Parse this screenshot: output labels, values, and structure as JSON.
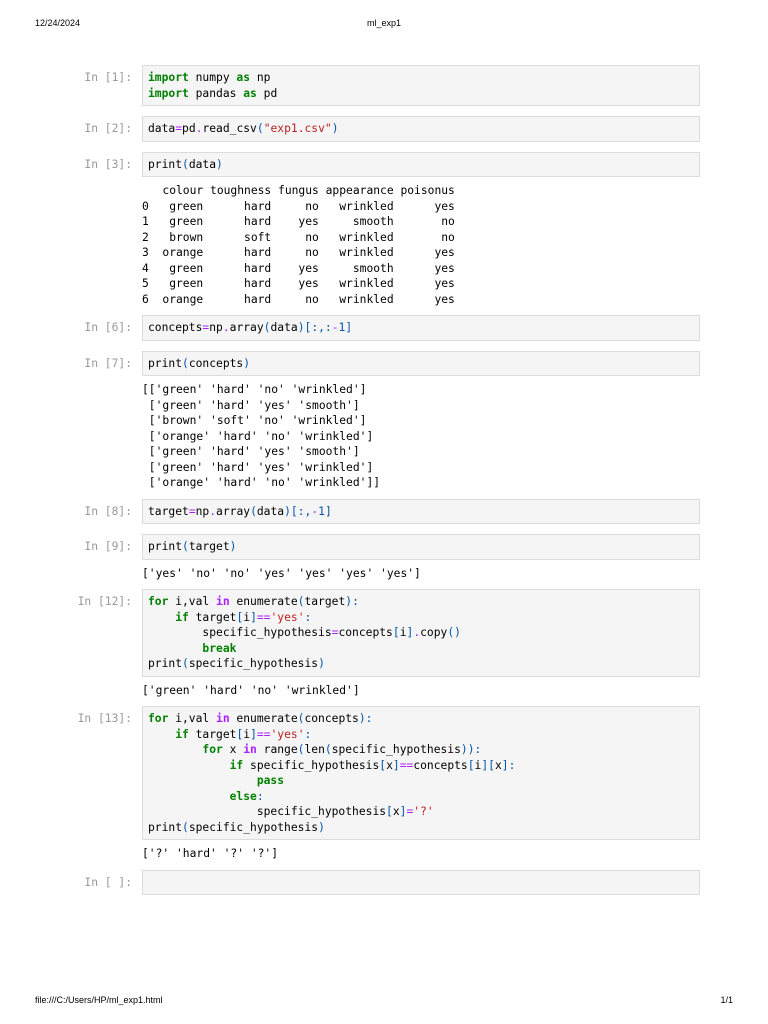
{
  "header": {
    "date": "12/24/2024",
    "title": "ml_exp1"
  },
  "footer": {
    "path": "file:///C:/Users/HP/ml_exp1.html",
    "page": "1/1"
  },
  "cells": [
    {
      "prompt": "In [1]:",
      "code": [
        [
          [
            "import",
            "kw"
          ],
          [
            " numpy ",
            ""
          ],
          [
            "as",
            "kw"
          ],
          [
            " np",
            ""
          ]
        ],
        [
          [
            "import",
            "kw"
          ],
          [
            " pandas ",
            ""
          ],
          [
            "as",
            "kw"
          ],
          [
            " pd",
            ""
          ]
        ]
      ],
      "output": null
    },
    {
      "prompt": "In [2]:",
      "code": [
        [
          [
            "data",
            ""
          ],
          [
            "=",
            "eq"
          ],
          [
            "pd",
            ""
          ],
          [
            ".",
            "eq"
          ],
          [
            "read_csv",
            ""
          ],
          [
            "(",
            "br"
          ],
          [
            "\"exp1.csv\"",
            "str"
          ],
          [
            ")",
            "br"
          ]
        ]
      ],
      "output": null
    },
    {
      "prompt": "In [3]:",
      "code": [
        [
          [
            "print",
            ""
          ],
          [
            "(",
            "br"
          ],
          [
            "data",
            ""
          ],
          [
            ")",
            "br"
          ]
        ]
      ],
      "output": "   colour toughness fungus appearance poisonus\n0   green      hard     no   wrinkled      yes\n1   green      hard    yes     smooth       no\n2   brown      soft     no   wrinkled       no\n3  orange      hard     no   wrinkled      yes\n4   green      hard    yes     smooth      yes\n5   green      hard    yes   wrinkled      yes\n6  orange      hard     no   wrinkled      yes"
    },
    {
      "prompt": "In [6]:",
      "code": [
        [
          [
            "concepts",
            ""
          ],
          [
            "=",
            "eq"
          ],
          [
            "np",
            ""
          ],
          [
            ".",
            "eq"
          ],
          [
            "array",
            ""
          ],
          [
            "(",
            "br"
          ],
          [
            "data",
            ""
          ],
          [
            ")",
            "br"
          ],
          [
            "[",
            "br"
          ],
          [
            ":,:",
            "br"
          ],
          [
            "-",
            "eq"
          ],
          [
            "1",
            "br"
          ],
          [
            "]",
            "br"
          ]
        ]
      ],
      "output": null
    },
    {
      "prompt": "In [7]:",
      "code": [
        [
          [
            "print",
            ""
          ],
          [
            "(",
            "br"
          ],
          [
            "concepts",
            ""
          ],
          [
            ")",
            "br"
          ]
        ]
      ],
      "output": "[['green' 'hard' 'no' 'wrinkled']\n ['green' 'hard' 'yes' 'smooth']\n ['brown' 'soft' 'no' 'wrinkled']\n ['orange' 'hard' 'no' 'wrinkled']\n ['green' 'hard' 'yes' 'smooth']\n ['green' 'hard' 'yes' 'wrinkled']\n ['orange' 'hard' 'no' 'wrinkled']]"
    },
    {
      "prompt": "In [8]:",
      "code": [
        [
          [
            "target",
            ""
          ],
          [
            "=",
            "eq"
          ],
          [
            "np",
            ""
          ],
          [
            ".",
            "eq"
          ],
          [
            "array",
            ""
          ],
          [
            "(",
            "br"
          ],
          [
            "data",
            ""
          ],
          [
            ")",
            "br"
          ],
          [
            "[",
            "br"
          ],
          [
            ":,",
            "br"
          ],
          [
            "-",
            "eq"
          ],
          [
            "1",
            "br"
          ],
          [
            "]",
            "br"
          ]
        ]
      ],
      "output": null
    },
    {
      "prompt": "In [9]:",
      "code": [
        [
          [
            "print",
            ""
          ],
          [
            "(",
            "br"
          ],
          [
            "target",
            ""
          ],
          [
            ")",
            "br"
          ]
        ]
      ],
      "output": "['yes' 'no' 'no' 'yes' 'yes' 'yes' 'yes']"
    },
    {
      "prompt": "In [12]:",
      "code": [
        [
          [
            "for",
            "kw"
          ],
          [
            " i,val ",
            ""
          ],
          [
            "in",
            "op"
          ],
          [
            " enumerate",
            ""
          ],
          [
            "(",
            "br"
          ],
          [
            "target",
            ""
          ],
          [
            "):",
            "br"
          ]
        ],
        [
          [
            "    ",
            ""
          ],
          [
            "if",
            "kw"
          ],
          [
            " target",
            ""
          ],
          [
            "[",
            "br"
          ],
          [
            "i",
            ""
          ],
          [
            "]",
            "br"
          ],
          [
            "==",
            "eq"
          ],
          [
            "'yes'",
            "str"
          ],
          [
            ":",
            "br"
          ]
        ],
        [
          [
            "        specific_hypothesis",
            ""
          ],
          [
            "=",
            "eq"
          ],
          [
            "concepts",
            ""
          ],
          [
            "[",
            "br"
          ],
          [
            "i",
            ""
          ],
          [
            "]",
            "br"
          ],
          [
            ".",
            "eq"
          ],
          [
            "copy",
            ""
          ],
          [
            "()",
            "br"
          ]
        ],
        [
          [
            "        ",
            ""
          ],
          [
            "break",
            "kw"
          ]
        ],
        [
          [
            "print",
            ""
          ],
          [
            "(",
            "br"
          ],
          [
            "specific_hypothesis",
            ""
          ],
          [
            ")",
            "br"
          ]
        ]
      ],
      "output": "['green' 'hard' 'no' 'wrinkled']"
    },
    {
      "prompt": "In [13]:",
      "code": [
        [
          [
            "for",
            "kw"
          ],
          [
            " i,val ",
            ""
          ],
          [
            "in",
            "op"
          ],
          [
            " enumerate",
            ""
          ],
          [
            "(",
            "br"
          ],
          [
            "concepts",
            ""
          ],
          [
            "):",
            "br"
          ]
        ],
        [
          [
            "    ",
            ""
          ],
          [
            "if",
            "kw"
          ],
          [
            " target",
            ""
          ],
          [
            "[",
            "br"
          ],
          [
            "i",
            ""
          ],
          [
            "]",
            "br"
          ],
          [
            "==",
            "eq"
          ],
          [
            "'yes'",
            "str"
          ],
          [
            ":",
            "br"
          ]
        ],
        [
          [
            "        ",
            ""
          ],
          [
            "for",
            "kw"
          ],
          [
            " x ",
            ""
          ],
          [
            "in",
            "op"
          ],
          [
            " range",
            ""
          ],
          [
            "(",
            "br"
          ],
          [
            "len",
            ""
          ],
          [
            "(",
            "br"
          ],
          [
            "specific_hypothesis",
            ""
          ],
          [
            ")):",
            "br"
          ]
        ],
        [
          [
            "            ",
            ""
          ],
          [
            "if",
            "kw"
          ],
          [
            " specific_hypothesis",
            ""
          ],
          [
            "[",
            "br"
          ],
          [
            "x",
            ""
          ],
          [
            "]",
            "br"
          ],
          [
            "==",
            "eq"
          ],
          [
            "concepts",
            ""
          ],
          [
            "[",
            "br"
          ],
          [
            "i",
            ""
          ],
          [
            "][",
            "br"
          ],
          [
            "x",
            ""
          ],
          [
            "]:",
            "br"
          ]
        ],
        [
          [
            "                ",
            ""
          ],
          [
            "pass",
            "kw"
          ]
        ],
        [
          [
            "            ",
            ""
          ],
          [
            "else",
            "kw"
          ],
          [
            ":",
            "br"
          ]
        ],
        [
          [
            "                specific_hypothesis",
            ""
          ],
          [
            "[",
            "br"
          ],
          [
            "x",
            ""
          ],
          [
            "]",
            "br"
          ],
          [
            "=",
            "eq"
          ],
          [
            "'?'",
            "str"
          ]
        ],
        [
          [
            "print",
            ""
          ],
          [
            "(",
            "br"
          ],
          [
            "specific_hypothesis",
            ""
          ],
          [
            ")",
            "br"
          ]
        ]
      ],
      "output": "['?' 'hard' '?' '?']"
    },
    {
      "prompt": "In [ ]:",
      "code": [],
      "output": null
    }
  ]
}
